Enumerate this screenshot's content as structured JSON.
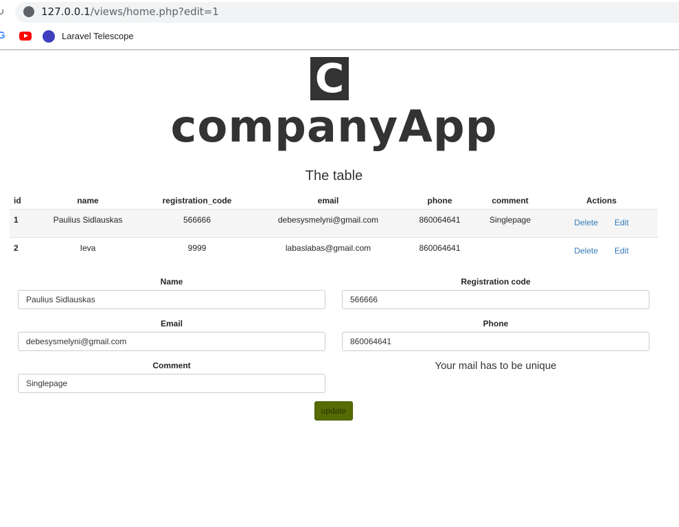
{
  "browser": {
    "url_host": "127.0.0.1",
    "url_path": "/views/home.php?edit=1",
    "bookmarks": [
      {
        "icon": "google-icon",
        "label": ""
      },
      {
        "icon": "youtube-icon",
        "label": ""
      },
      {
        "icon": "telescope-icon",
        "label": "Laravel Telescope"
      }
    ]
  },
  "logo": {
    "letter": "C",
    "text": "companyApp"
  },
  "title": "The table",
  "table": {
    "headers": [
      "id",
      "name",
      "registration_code",
      "email",
      "phone",
      "comment",
      "Actions"
    ],
    "rows": [
      [
        "1",
        "Paulius Sidlauskas",
        "566666",
        "debesysmelyni@gmail.com",
        "860064641",
        "Singlepage"
      ],
      [
        "2",
        "Ieva",
        "9999",
        "labaslabas@gmail.com",
        "860064641",
        ""
      ]
    ],
    "delete_label": "Delete",
    "edit_label": "Edit"
  },
  "form": {
    "name_label": "Name",
    "name_value": "Paulius Sidlauskas",
    "reg_label": "Registration code",
    "reg_value": "566666",
    "email_label": "Email",
    "email_value": "debesysmelyni@gmail.com",
    "phone_label": "Phone",
    "phone_value": "860064641",
    "comment_label": "Comment",
    "comment_value": "Singlepage",
    "note": "Your mail has to be unique",
    "update_label": "update"
  },
  "colors": {
    "update_button": "#566b04",
    "link": "#337ab7"
  }
}
